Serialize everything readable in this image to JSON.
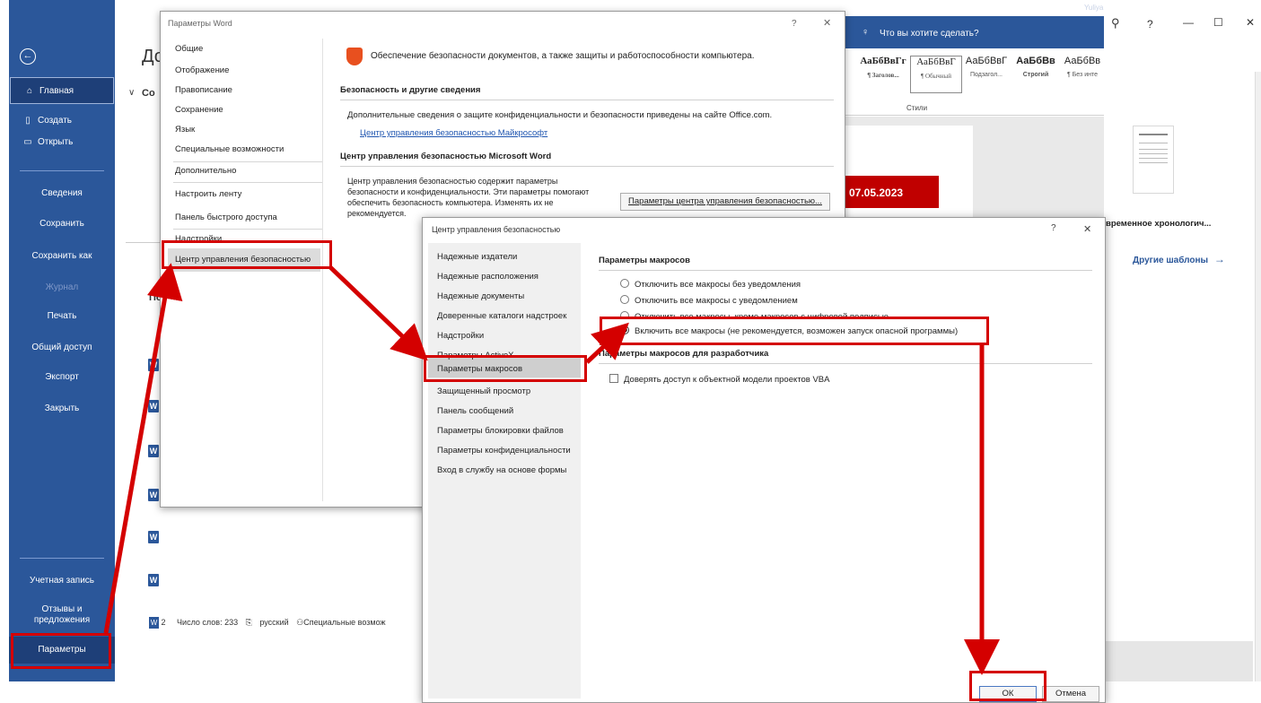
{
  "window": {
    "user": "Yuliya",
    "controls": [
      "?",
      "—",
      "☐",
      "✕"
    ],
    "search_placeholder": "Что вы хотите сделать?"
  },
  "backstage": {
    "title": "До",
    "sub_label": "Со",
    "section_label": "По",
    "nav_top": [
      {
        "label": "Главная",
        "icon": "home-icon"
      },
      {
        "label": "Создать",
        "icon": "new-document-icon"
      },
      {
        "label": "Открыть",
        "icon": "folder-open-icon"
      }
    ],
    "nav_middle": [
      "Сведения",
      "Сохранить",
      "Сохранить как",
      "Журнал",
      "Печать",
      "Общий доступ",
      "Экспорт",
      "Закрыть"
    ],
    "nav_bottom": [
      "Учетная запись",
      "Отзывы и предложения",
      "Параметры"
    ]
  },
  "ribbon": {
    "styles": [
      {
        "sample": "АаБбВвГг",
        "name": "¶ Заголов..."
      },
      {
        "sample": "АаБбВвГ",
        "name": "¶ Обычный"
      },
      {
        "sample": "АаБбВвГ",
        "name": "Подзагол..."
      },
      {
        "sample": "АаБбВв",
        "name": "Строгий"
      },
      {
        "sample": "АаБбВв",
        "name": "¶ Без инте"
      }
    ],
    "styles_group": "Стили"
  },
  "document": {
    "date": "07.05.2023",
    "status_page": "2",
    "status_words": "Число слов: 233",
    "status_lang": "русский",
    "status_access": "Специальные возмож"
  },
  "templates": {
    "template_name": "временное хронологич...",
    "more_templates": "Другие шаблоны",
    "more_arrow": "→"
  },
  "word_options": {
    "title": "Параметры Word",
    "help": "?",
    "close": "✕",
    "nav": [
      "Общие",
      "Отображение",
      "Правописание",
      "Сохранение",
      "Язык",
      "Специальные возможности",
      "Дополнительно",
      "Настроить ленту",
      "Панель быстрого доступа",
      "Надстройки",
      "Центр управления безопасностью"
    ],
    "header": "Обеспечение безопасности документов, а также защиты и работоспособности компьютера.",
    "sec1_title": "Безопасность и другие сведения",
    "sec1_text": "Дополнительные сведения о защите конфиденциальности и безопасности приведены на сайте Office.com.",
    "sec1_link": "Центр управления безопасностью Майкрософт",
    "sec2_title": "Центр управления безопасностью Microsoft Word",
    "sec2_text": [
      "Центр управления безопасностью содержит параметры",
      "безопасности и конфиденциальности. Эти параметры помогают",
      "обеспечить безопасность компьютера. Изменять их не",
      "рекомендуется."
    ],
    "sec2_button": "Параметры центра управления безопасностью..."
  },
  "trust_center": {
    "title": "Центр управления безопасностью",
    "help": "?",
    "close": "✕",
    "nav": [
      "Надежные издатели",
      "Надежные расположения",
      "Надежные документы",
      "Доверенные каталоги надстроек",
      "Надстройки",
      "Параметры ActiveX",
      "Параметры макросов",
      "Защищенный просмотр",
      "Панель сообщений",
      "Параметры блокировки файлов",
      "Параметры конфиденциальности",
      "Вход в службу на основе формы"
    ],
    "macro_title": "Параметры макросов",
    "macro_options": [
      {
        "label": "Отключить все макросы без уведомления",
        "selected": false
      },
      {
        "label": "Отключить все макросы с уведомлением",
        "selected": false
      },
      {
        "label": "Отключить все макросы, кроме макросов с цифровой подписью",
        "selected": false
      },
      {
        "label": "Включить все макросы (не рекомендуется, возможен запуск опасной программы)",
        "selected": true
      }
    ],
    "dev_title": "Параметры макросов для разработчика",
    "dev_checkbox": "Доверять доступ к объектной модели проектов VBA",
    "ok": "ОК",
    "cancel": "Отмена"
  },
  "colors": {
    "word_blue": "#2b579a",
    "highlight_red": "#d40000",
    "date_red": "#c00000"
  }
}
